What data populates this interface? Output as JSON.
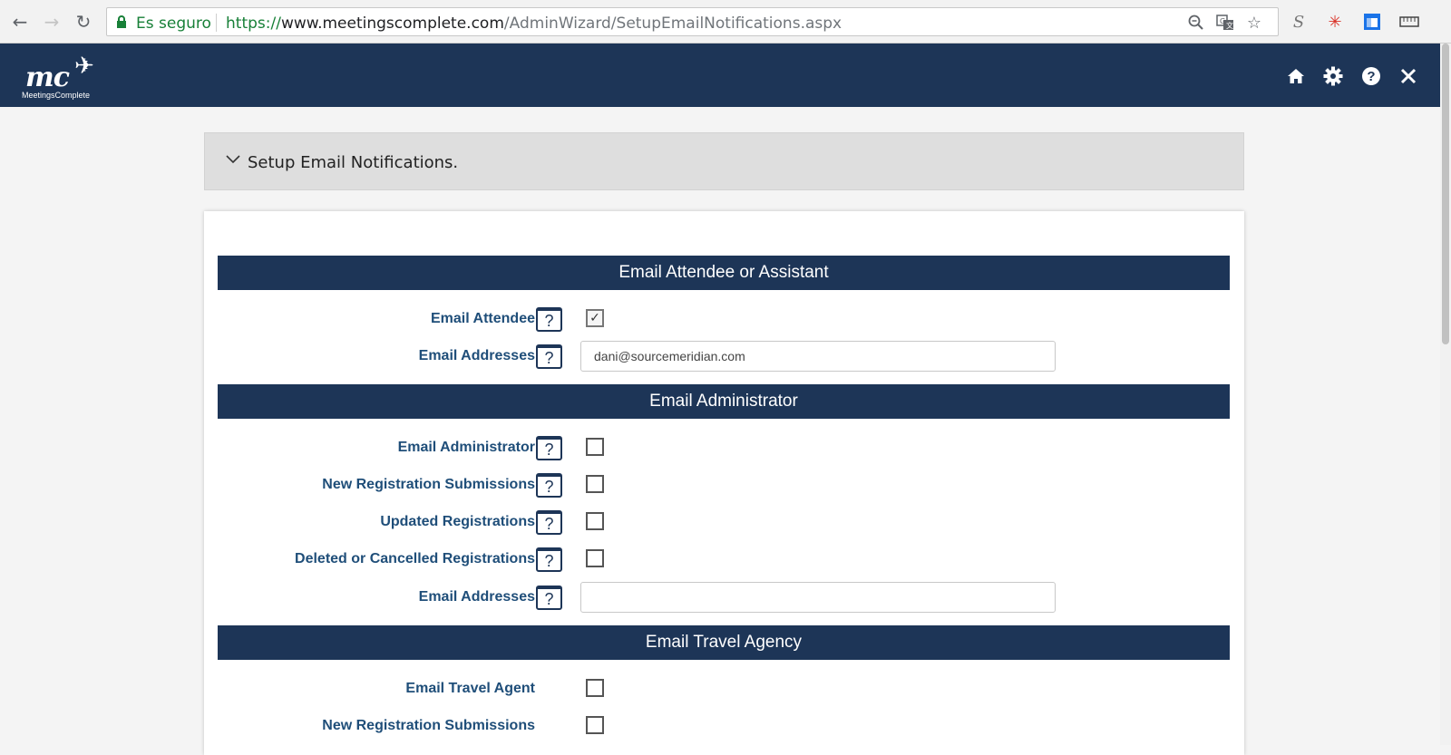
{
  "browser": {
    "secure_label": "Es seguro",
    "url_protocol": "https://",
    "url_host": "www.meetingscomplete.com",
    "url_path": "/AdminWizard/SetupEmailNotifications.aspx",
    "icons": [
      "back-icon",
      "forward-icon",
      "reload-icon",
      "lock-icon",
      "zoom-icon",
      "translate-icon",
      "star-icon",
      "extension-s-icon",
      "extension-asterisk-icon",
      "extension-window-icon",
      "ruler-icon"
    ]
  },
  "app": {
    "logo_text": "mc",
    "logo_subtext": "MeetingsComplete",
    "header_icons": [
      "home-icon",
      "gear-icon",
      "help-icon",
      "close-icon"
    ],
    "brand_color": "#1d3557"
  },
  "accordion": {
    "title": "Setup Email Notifications."
  },
  "help_glyph": "?",
  "sections": [
    {
      "title": "Email Attendee or Assistant",
      "rows": [
        {
          "label": "Email Attendee",
          "type": "checkbox",
          "checked": true,
          "check_glyph": "✓"
        },
        {
          "label": "Email Addresses",
          "type": "text",
          "value": "dani@sourcemeridian.com"
        }
      ]
    },
    {
      "title": "Email Administrator",
      "rows": [
        {
          "label": "Email Administrator",
          "type": "checkbox",
          "checked": false
        },
        {
          "label": "New Registration Submissions",
          "type": "checkbox",
          "checked": false
        },
        {
          "label": "Updated Registrations",
          "type": "checkbox",
          "checked": false
        },
        {
          "label": "Deleted or Cancelled Registrations",
          "type": "checkbox",
          "checked": false
        },
        {
          "label": "Email Addresses",
          "type": "text",
          "value": ""
        }
      ]
    },
    {
      "title": "Email Travel Agency",
      "rows": [
        {
          "label": "Email Travel Agent",
          "type": "checkbox",
          "checked": false
        },
        {
          "label": "New Registration Submissions",
          "type": "checkbox",
          "checked": false
        }
      ]
    }
  ]
}
